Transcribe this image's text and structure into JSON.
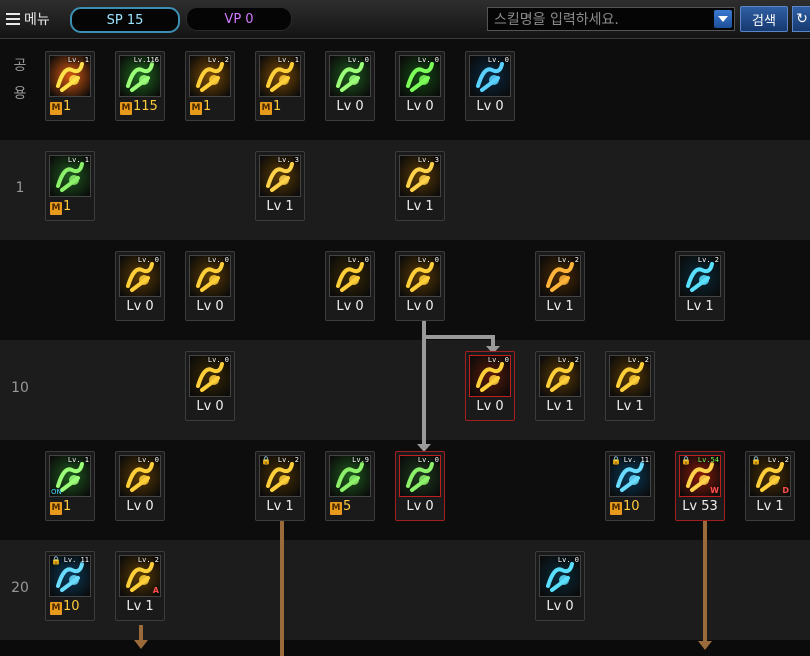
{
  "toolbar": {
    "menu_label": "메뉴",
    "sp_label": "SP 15",
    "vp_label": "VP 0",
    "search_placeholder": "스킬명을 입력하세요.",
    "search_button": "검색"
  },
  "rows": [
    {
      "label": "공\n용"
    },
    {
      "label": "1"
    },
    {
      "label": ""
    },
    {
      "label": "10"
    },
    {
      "label": ""
    },
    {
      "label": "20"
    }
  ],
  "skills": [
    {
      "row": 0,
      "col": 0,
      "name": "skill-fire-explosion",
      "badge": "Lv. 1",
      "mastery": true,
      "value": "1",
      "bg": "#d85a12",
      "glyph": "#ffe14a"
    },
    {
      "row": 0,
      "col": 1,
      "name": "skill-green-leap",
      "badge": "Lv.116",
      "mastery": true,
      "value": "115",
      "bg": "#1f6a1f",
      "glyph": "#9cff7a"
    },
    {
      "row": 0,
      "col": 2,
      "name": "skill-golden-kick",
      "badge": "Lv. 2",
      "mastery": true,
      "value": "1",
      "bg": "#7a4a05",
      "glyph": "#ffcf3a"
    },
    {
      "row": 0,
      "col": 3,
      "name": "skill-golden-stance",
      "badge": "Lv. 1",
      "mastery": true,
      "value": "1",
      "bg": "#7a4a05",
      "glyph": "#ffcf3a"
    },
    {
      "row": 0,
      "col": 4,
      "name": "skill-green-sitting",
      "badge": "Lv. 0",
      "mastery": false,
      "value": "Lv 0",
      "bg": "#1f5a1f",
      "glyph": "#9cff7a"
    },
    {
      "row": 0,
      "col": 5,
      "name": "skill-target-aim",
      "badge": "Lv. 0",
      "mastery": false,
      "value": "Lv 0",
      "bg": "#144a14",
      "glyph": "#7dff5a"
    },
    {
      "row": 0,
      "col": 6,
      "name": "skill-blue-eagle",
      "badge": "Lv. 0",
      "mastery": false,
      "value": "Lv 0",
      "bg": "#0a2a44",
      "glyph": "#5ad2ff"
    },
    {
      "row": 1,
      "col": 0,
      "name": "skill-green-fist",
      "badge": "Lv. 1",
      "mastery": true,
      "value": "1",
      "bg": "#1f5a1f",
      "glyph": "#8cf06a"
    },
    {
      "row": 1,
      "col": 3,
      "name": "skill-star-dash",
      "badge": "Lv. 3",
      "mastery": false,
      "value": "Lv 1",
      "bg": "#5a3a04",
      "glyph": "#ffd24a"
    },
    {
      "row": 1,
      "col": 5,
      "name": "skill-claw-strike",
      "badge": "Lv. 3",
      "mastery": false,
      "value": "Lv 1",
      "bg": "#5a3a04",
      "glyph": "#ffd24a"
    },
    {
      "row": 2,
      "col": 1,
      "name": "skill-whip-arc",
      "badge": "Lv. 0",
      "mastery": false,
      "value": "Lv 0",
      "bg": "#5a3a04",
      "glyph": "#ffcf3a"
    },
    {
      "row": 2,
      "col": 2,
      "name": "skill-low-kick",
      "badge": "Lv. 0",
      "mastery": false,
      "value": "Lv 0",
      "bg": "#5a3a04",
      "glyph": "#ffcf3a"
    },
    {
      "row": 2,
      "col": 4,
      "name": "skill-orbit-spheres",
      "badge": "Lv. 0",
      "mastery": false,
      "value": "Lv 0",
      "bg": "#3a2a04",
      "glyph": "#ffcf3a"
    },
    {
      "row": 2,
      "col": 5,
      "name": "skill-fire-punch",
      "badge": "Lv. 0",
      "mastery": false,
      "value": "Lv 0",
      "bg": "#5a3a04",
      "glyph": "#ffcf3a"
    },
    {
      "row": 2,
      "col": 7,
      "name": "skill-pentagram",
      "badge": "Lv. 2",
      "mastery": false,
      "value": "Lv 1",
      "bg": "#4a2a04",
      "glyph": "#ffb43a"
    },
    {
      "row": 2,
      "col": 9,
      "name": "skill-blue-orbit",
      "badge": "Lv. 2",
      "mastery": false,
      "value": "Lv 1",
      "bg": "#0a2a3a",
      "glyph": "#5ae0ff"
    },
    {
      "row": 3,
      "col": 2,
      "name": "skill-golden-whip",
      "badge": "Lv. 0",
      "mastery": false,
      "value": "Lv 0",
      "bg": "#3a2a04",
      "glyph": "#ffcf3a"
    },
    {
      "row": 3,
      "col": 6,
      "name": "skill-hand-grab",
      "badge": "Lv. 0",
      "mastery": false,
      "value": "Lv 0",
      "bg": "#5a1a0a",
      "glyph": "#ffcf3a",
      "red": true
    },
    {
      "row": 3,
      "col": 7,
      "name": "skill-slide-kick",
      "badge": "Lv. 2",
      "mastery": false,
      "value": "Lv 1",
      "bg": "#5a3a04",
      "glyph": "#ffcf3a"
    },
    {
      "row": 3,
      "col": 8,
      "name": "skill-burst-fist",
      "badge": "Lv. 2",
      "mastery": false,
      "value": "Lv 1",
      "bg": "#5a3a04",
      "glyph": "#ffcf3a"
    },
    {
      "row": 4,
      "col": 0,
      "name": "skill-green-dance",
      "badge": "Lv. 1",
      "mastery": true,
      "value": "1",
      "bg": "#1f5a1f",
      "glyph": "#9cff7a",
      "on": true
    },
    {
      "row": 4,
      "col": 1,
      "name": "skill-golden-rise",
      "badge": "Lv. 0",
      "mastery": false,
      "value": "Lv 0",
      "bg": "#5a3a04",
      "glyph": "#ffcf3a"
    },
    {
      "row": 4,
      "col": 3,
      "name": "skill-lightning-kick",
      "badge": "Lv. 2",
      "mastery": false,
      "value": "Lv 1",
      "bg": "#4a3004",
      "glyph": "#ffcf3a",
      "lock": true
    },
    {
      "row": 4,
      "col": 4,
      "name": "skill-green-fortress",
      "badge": "Lv.9",
      "mastery": true,
      "value": "5",
      "bg": "#1f5a1f",
      "glyph": "#8cf06a"
    },
    {
      "row": 4,
      "col": 5,
      "name": "skill-beast-roar",
      "badge": "Lv. 0",
      "mastery": false,
      "value": "Lv 0",
      "bg": "#1f3a1f",
      "glyph": "#8cf06a",
      "red": true
    },
    {
      "row": 4,
      "col": 8,
      "name": "skill-blue-tome",
      "badge": "Lv. 11",
      "mastery": true,
      "value": "10",
      "bg": "#0a3a5a",
      "glyph": "#6adcff",
      "lock": true
    },
    {
      "row": 4,
      "col": 9,
      "name": "skill-crimson-fist",
      "badge": "Lv.54",
      "mastery": false,
      "value": "Lv 53",
      "bg": "#8a1a0a",
      "glyph": "#ffd24a",
      "lock": true,
      "red": true,
      "corner": "W"
    },
    {
      "row": 4,
      "col": 10,
      "name": "skill-golden-gauntlet",
      "badge": "Lv. 2",
      "mastery": false,
      "value": "Lv 1",
      "bg": "#4a3004",
      "glyph": "#ffcf3a",
      "lock": true,
      "corner": "D"
    },
    {
      "row": 5,
      "col": 0,
      "name": "skill-blue-guardian",
      "badge": "Lv. 11",
      "mastery": true,
      "value": "10",
      "bg": "#0a3a5a",
      "glyph": "#6adcff",
      "lock": true
    },
    {
      "row": 5,
      "col": 1,
      "name": "skill-golden-tornado",
      "badge": "Lv. 2",
      "mastery": false,
      "value": "Lv 1",
      "bg": "#5a3a04",
      "glyph": "#ffcf3a",
      "corner": "A"
    },
    {
      "row": 5,
      "col": 7,
      "name": "skill-blue-spark",
      "badge": "Lv. 0",
      "mastery": false,
      "value": "Lv 0",
      "bg": "#0a2a3a",
      "glyph": "#5ae0ff"
    }
  ],
  "colors": {
    "mastery_value": "#ffcc3c",
    "connector_gray": "#9a9a9a",
    "connector_brown": "#9a6a3a"
  }
}
